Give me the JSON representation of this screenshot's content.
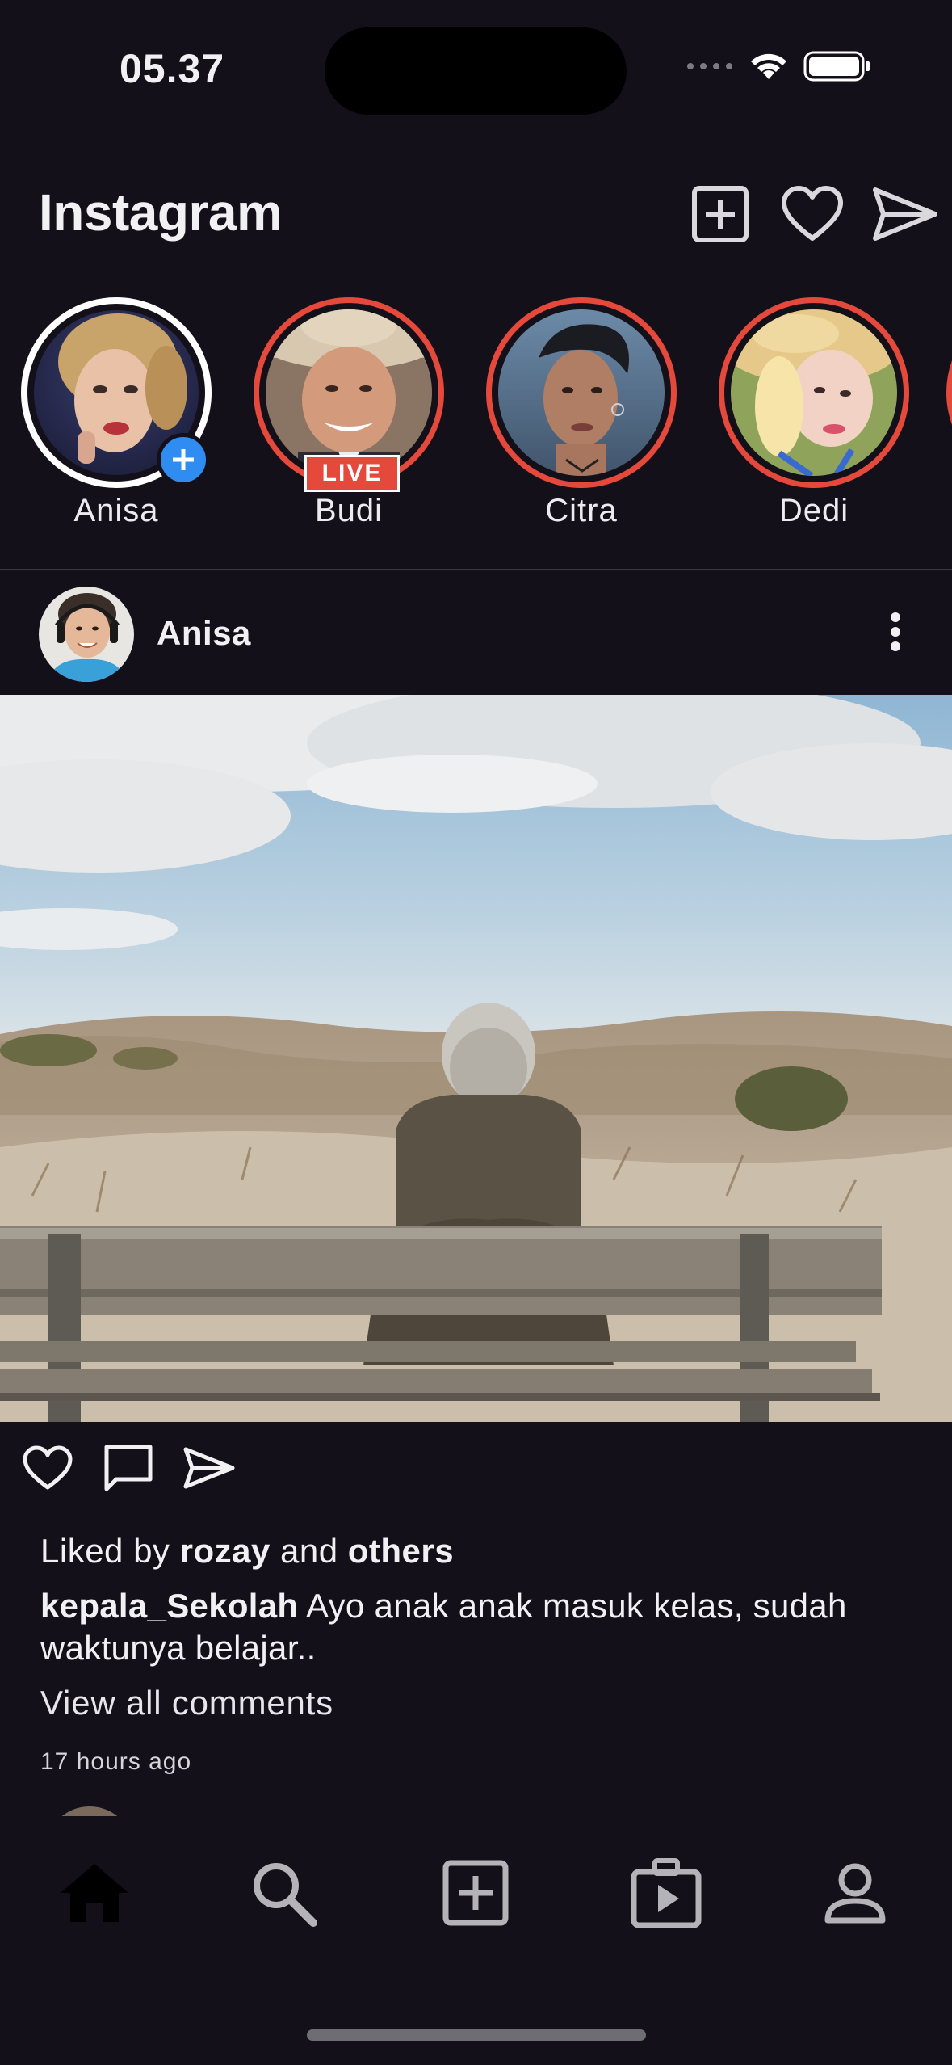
{
  "status_bar": {
    "time": "05.37"
  },
  "header": {
    "title": "Instagram",
    "actions": [
      "add-post-icon",
      "heart-icon",
      "send-icon"
    ]
  },
  "stories": [
    {
      "name": "Anisa",
      "type": "own",
      "badge": "+"
    },
    {
      "name": "Budi",
      "type": "unseen",
      "badge": "LIVE"
    },
    {
      "name": "Citra",
      "type": "unseen",
      "badge": ""
    },
    {
      "name": "Dedi",
      "type": "unseen",
      "badge": ""
    }
  ],
  "post": {
    "username": "Anisa",
    "likes": {
      "prefix": "Liked by",
      "user": "rozay",
      "joiner": "and",
      "others": "others"
    },
    "caption": {
      "username": "kepala_Sekolah",
      "text": "Ayo anak anak masuk kelas, sudah waktunya belajar.."
    },
    "view_comments": "View all comments",
    "time_ago": "17 hours ago"
  },
  "bottom_nav": {
    "items": [
      "home-icon",
      "search-icon",
      "add-icon",
      "reels-icon",
      "profile-icon"
    ],
    "active": "home-icon"
  },
  "colors": {
    "background": "#131019",
    "story_ring": "#e5493c",
    "add_badge": "#2f8cf0",
    "text": "#f1f1f3"
  }
}
